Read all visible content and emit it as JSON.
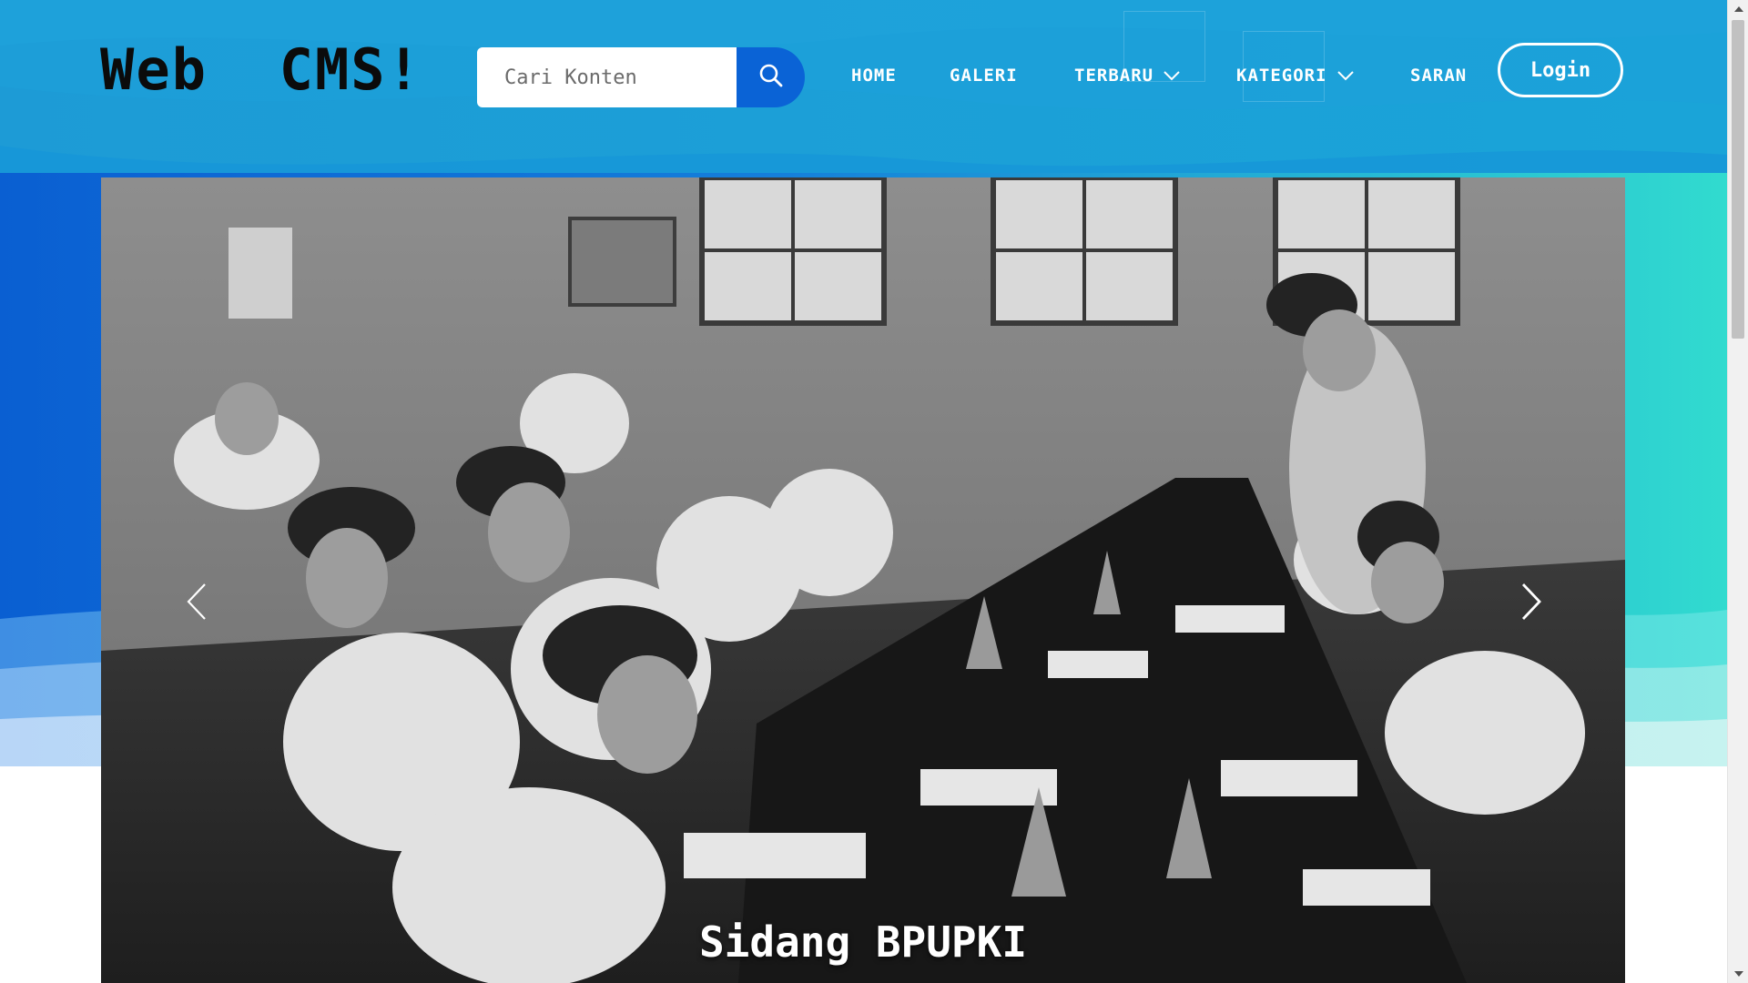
{
  "brand": {
    "title": "Web  CMS!"
  },
  "search": {
    "placeholder": "Cari Konten",
    "button_icon": "search-icon"
  },
  "nav": {
    "items": [
      {
        "label": "HOME",
        "has_dropdown": false
      },
      {
        "label": "GALERI",
        "has_dropdown": false
      },
      {
        "label": "TERBARU",
        "has_dropdown": true
      },
      {
        "label": "KATEGORI",
        "has_dropdown": true
      },
      {
        "label": "SARAN",
        "has_dropdown": false
      }
    ],
    "login_label": "Login"
  },
  "carousel": {
    "caption": "Sidang BPUPKI",
    "prev_icon": "chevron-left-icon",
    "next_icon": "chevron-right-icon"
  },
  "colors": {
    "header_top": "#1c9fd8",
    "header_accent": "#0a63d6",
    "header_teal": "#2fd9cf",
    "text_dark": "#0b0b0b",
    "white": "#ffffff"
  }
}
